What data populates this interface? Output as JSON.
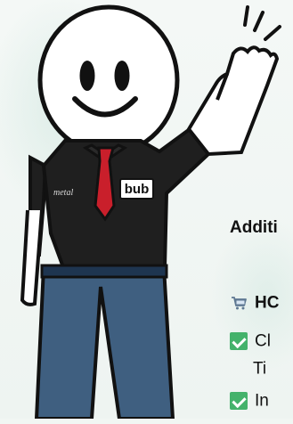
{
  "panel": {
    "title": "Additi",
    "items": [
      {
        "icon": "shopping-cart-icon",
        "label": "HC"
      },
      {
        "icon": "checkmark-icon",
        "label": "Cl"
      },
      {
        "label": "Ti"
      },
      {
        "icon": "checkmark-icon",
        "label": "In"
      }
    ]
  },
  "mascot": {
    "badge": "bub",
    "signature": "metal"
  },
  "colors": {
    "background": "#f1f6f3",
    "accent_green": "#44b26b",
    "shirt": "#1f1f1f",
    "tie": "#c91f2b",
    "pants": "#3f5f80"
  }
}
